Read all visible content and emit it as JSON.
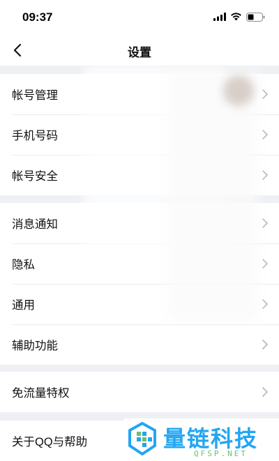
{
  "status_bar": {
    "time": "09:37"
  },
  "nav": {
    "title": "设置"
  },
  "groups": [
    {
      "items": [
        {
          "label": "帐号管理"
        },
        {
          "label": "手机号码"
        },
        {
          "label": "帐号安全"
        }
      ]
    },
    {
      "items": [
        {
          "label": "消息通知"
        },
        {
          "label": "隐私"
        },
        {
          "label": "通用"
        },
        {
          "label": "辅助功能"
        }
      ]
    },
    {
      "items": [
        {
          "label": "免流量特权"
        }
      ]
    },
    {
      "items": [
        {
          "label": "关于QQ与帮助"
        }
      ]
    }
  ],
  "watermark": {
    "title": "量链科技",
    "subtitle": "QFSP.NET"
  },
  "colors": {
    "background": "#eef0f4",
    "card": "#ffffff",
    "chevron": "#b5b5b5",
    "watermark_blue": "#22a6f2",
    "watermark_green": "#6cc070"
  }
}
